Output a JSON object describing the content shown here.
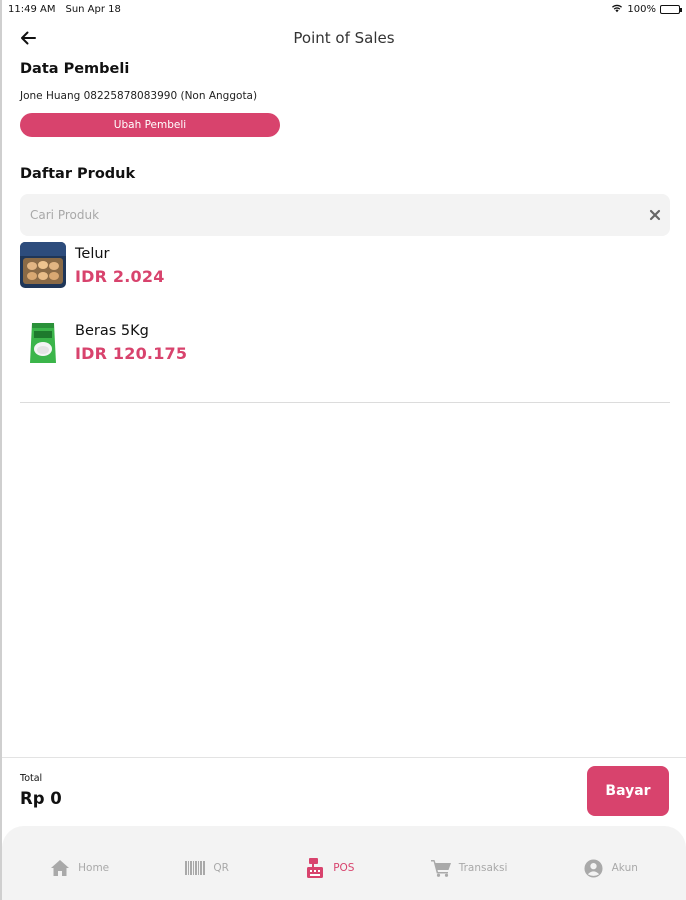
{
  "status_bar": {
    "time": "11:49 AM",
    "date": "Sun Apr 18",
    "battery": "100%"
  },
  "header": {
    "title": "Point of Sales"
  },
  "buyer": {
    "section_title": "Data Pembeli",
    "info": "Jone Huang 08225878083990 (Non Anggota)",
    "change_button": "Ubah Pembeli"
  },
  "products": {
    "section_title": "Daftar Produk",
    "search_placeholder": "Cari Produk",
    "items": [
      {
        "name": "Telur",
        "price": "IDR 2.024",
        "thumb_icon": "eggs-thumbnail"
      },
      {
        "name": "Beras 5Kg",
        "price": "IDR 120.175",
        "thumb_icon": "rice-bag-thumbnail"
      }
    ]
  },
  "footer": {
    "total_label": "Total",
    "total_value": "Rp 0",
    "pay_button": "Bayar"
  },
  "bottom_nav": [
    {
      "label": "Home",
      "icon": "home-icon",
      "active": false
    },
    {
      "label": "QR",
      "icon": "barcode-icon",
      "active": false
    },
    {
      "label": "POS",
      "icon": "cash-register-icon",
      "active": true
    },
    {
      "label": "Transaksi",
      "icon": "cart-icon",
      "active": false
    },
    {
      "label": "Akun",
      "icon": "account-icon",
      "active": false
    }
  ],
  "colors": {
    "accent": "#d8436d",
    "nav_bg": "#f3f3f3",
    "search_bg": "#f3f3f3"
  }
}
